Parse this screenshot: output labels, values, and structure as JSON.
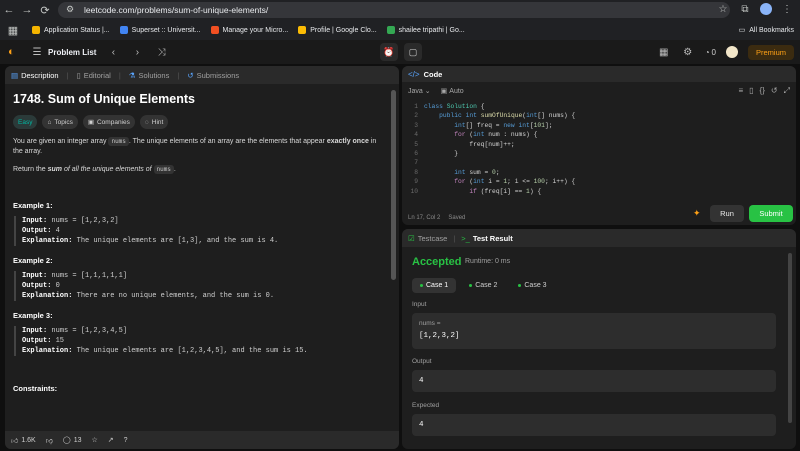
{
  "browser": {
    "url": "leetcode.com/problems/sum-of-unique-elements/",
    "bookmarks": [
      {
        "label": "Application Status |...",
        "color": "#f4b400"
      },
      {
        "label": "Superset :: Universit...",
        "color": "#4285f4"
      },
      {
        "label": "Manage your Micro...",
        "color": "#f25022"
      },
      {
        "label": "Profile | Google Clo...",
        "color": "#fbbc04"
      },
      {
        "label": "shailee tripathi | Go...",
        "color": "#34a853"
      }
    ],
    "all_bookmarks": "All Bookmarks"
  },
  "lc_header": {
    "problem_list": "Problem List",
    "notifications_count": "0",
    "premium": "Premium"
  },
  "left": {
    "tabs": [
      "Description",
      "Editorial",
      "Solutions",
      "Submissions"
    ],
    "title": "1748. Sum of Unique Elements",
    "pills": [
      "Easy",
      "Topics",
      "Companies",
      "Hint"
    ],
    "desc1_a": "You are given an integer array ",
    "desc1_code": "nums",
    "desc1_b": ". The unique elements of an array are the elements that appear ",
    "desc1_bold": "exactly once",
    "desc1_c": " in the array.",
    "desc2_a": "Return the ",
    "desc2_b": "sum",
    "desc2_c": " of all the unique elements of ",
    "desc2_code": "nums",
    "desc2_d": ".",
    "examples": [
      {
        "title": "Example 1:",
        "input": "nums = [1,2,3,2]",
        "output": "4",
        "explanation": "The unique elements are [1,3], and the sum is 4."
      },
      {
        "title": "Example 2:",
        "input": "nums = [1,1,1,1,1]",
        "output": "0",
        "explanation": "There are no unique elements, and the sum is 0."
      },
      {
        "title": "Example 3:",
        "input": "nums = [1,2,3,4,5]",
        "output": "15",
        "explanation": "The unique elements are [1,2,3,4,5], and the sum is 15."
      }
    ],
    "labels": {
      "input": "Input:",
      "output": "Output:",
      "explanation": "Explanation:"
    },
    "constraints": "Constraints:",
    "likes": "1.6K",
    "comments": "13"
  },
  "code": {
    "tab": "Code",
    "language": "Java",
    "mode": "Auto",
    "lines": [
      "1",
      "2",
      "3",
      "4",
      "5",
      "6",
      "7",
      "8",
      "9",
      "10"
    ],
    "status_pos": "Ln 17, Col 2",
    "status_saved": "Saved",
    "run": "Run",
    "submit": "Submit"
  },
  "result": {
    "tabs": [
      "Testcase",
      "Test Result"
    ],
    "status": "Accepted",
    "runtime": "Runtime: 0 ms",
    "cases": [
      "Case 1",
      "Case 2",
      "Case 3"
    ],
    "input_label": "Input",
    "input_name": "nums =",
    "input_value": "[1,2,3,2]",
    "output_label": "Output",
    "output_value": "4",
    "expected_label": "Expected",
    "expected_value": "4"
  }
}
